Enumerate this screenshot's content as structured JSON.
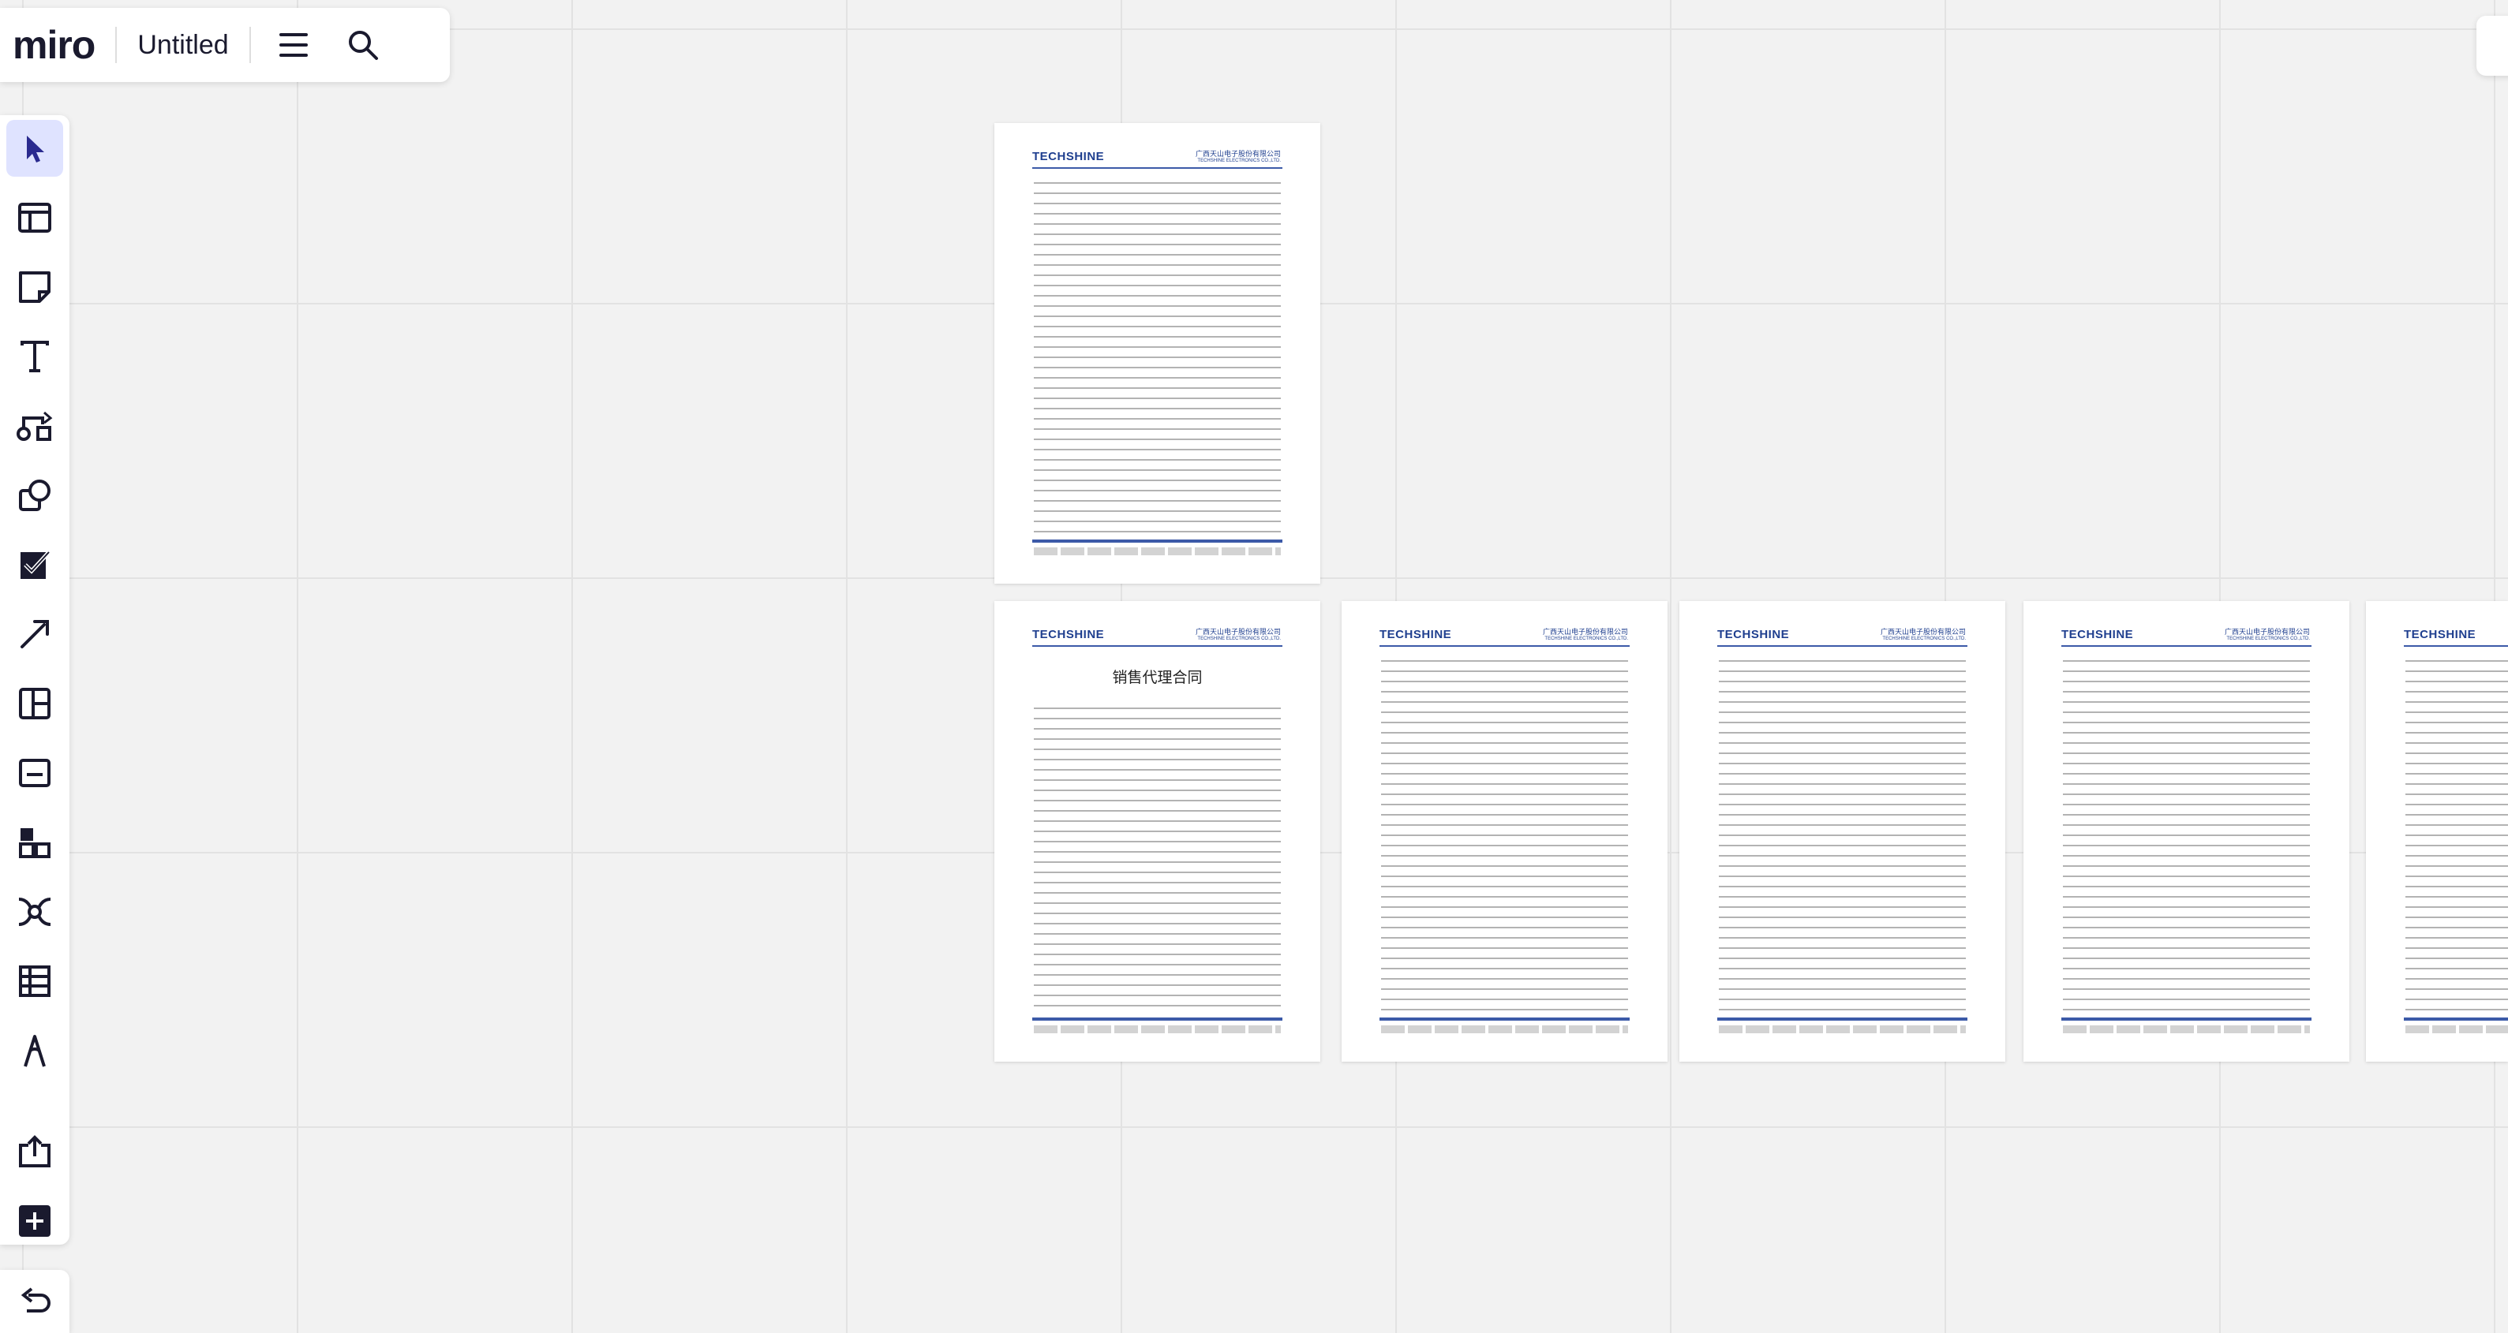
{
  "app": {
    "logo": "miro",
    "board_title": "Untitled"
  },
  "topbar_icons": [
    "menu-icon",
    "search-icon"
  ],
  "toolbar": {
    "tools": [
      {
        "name": "select",
        "icon": "cursor-icon",
        "active": true
      },
      {
        "name": "templates",
        "icon": "templates-icon",
        "active": false
      },
      {
        "name": "sticky-note",
        "icon": "sticky-note-icon",
        "active": false
      },
      {
        "name": "text",
        "icon": "text-icon",
        "active": false
      },
      {
        "name": "diagram",
        "icon": "diagram-icon",
        "active": false
      },
      {
        "name": "shapes",
        "icon": "shapes-icon",
        "active": false
      },
      {
        "name": "checklist",
        "icon": "checklist-icon",
        "active": false
      },
      {
        "name": "connection-line",
        "icon": "arrow-line-icon",
        "active": false
      },
      {
        "name": "frame",
        "icon": "frame-icon",
        "active": false
      },
      {
        "name": "card",
        "icon": "card-icon",
        "active": false
      },
      {
        "name": "layouts",
        "icon": "layouts-icon",
        "active": false
      },
      {
        "name": "mind-map",
        "icon": "mind-map-icon",
        "active": false
      },
      {
        "name": "table",
        "icon": "table-icon",
        "active": false
      },
      {
        "name": "pen",
        "icon": "pen-icon",
        "active": false
      },
      {
        "name": "upload",
        "icon": "upload-icon",
        "active": false
      },
      {
        "name": "more-apps",
        "icon": "plus-icon",
        "active": false
      }
    ],
    "undo_icon": "undo-icon"
  },
  "document_pages": [
    {
      "brand": "TECHSHINE",
      "company": "广西天山电子股份有限公司",
      "company_en": "TECHSHINE ELECTRONICS CO.,LTD.",
      "title": ""
    },
    {
      "brand": "TECHSHINE",
      "company": "广西天山电子股份有限公司",
      "company_en": "TECHSHINE ELECTRONICS CO.,LTD.",
      "title": "销售代理合同"
    },
    {
      "brand": "TECHSHINE",
      "company": "广西天山电子股份有限公司",
      "company_en": "TECHSHINE ELECTRONICS CO.,LTD.",
      "title": ""
    },
    {
      "brand": "TECHSHINE",
      "company": "广西天山电子股份有限公司",
      "company_en": "TECHSHINE ELECTRONICS CO.,LTD.",
      "title": ""
    },
    {
      "brand": "TECHSHINE",
      "company": "广西天山电子股份有限公司",
      "company_en": "TECHSHINE ELECTRONICS CO.,LTD.",
      "title": ""
    },
    {
      "brand": "TECHSHINE",
      "company": "",
      "company_en": "",
      "title": ""
    }
  ],
  "colors": {
    "accent": "#4262ff",
    "tool_active_bg": "#dfe3ff",
    "canvas": "#f2f2f2",
    "brand_blue": "#1f3f8f"
  }
}
